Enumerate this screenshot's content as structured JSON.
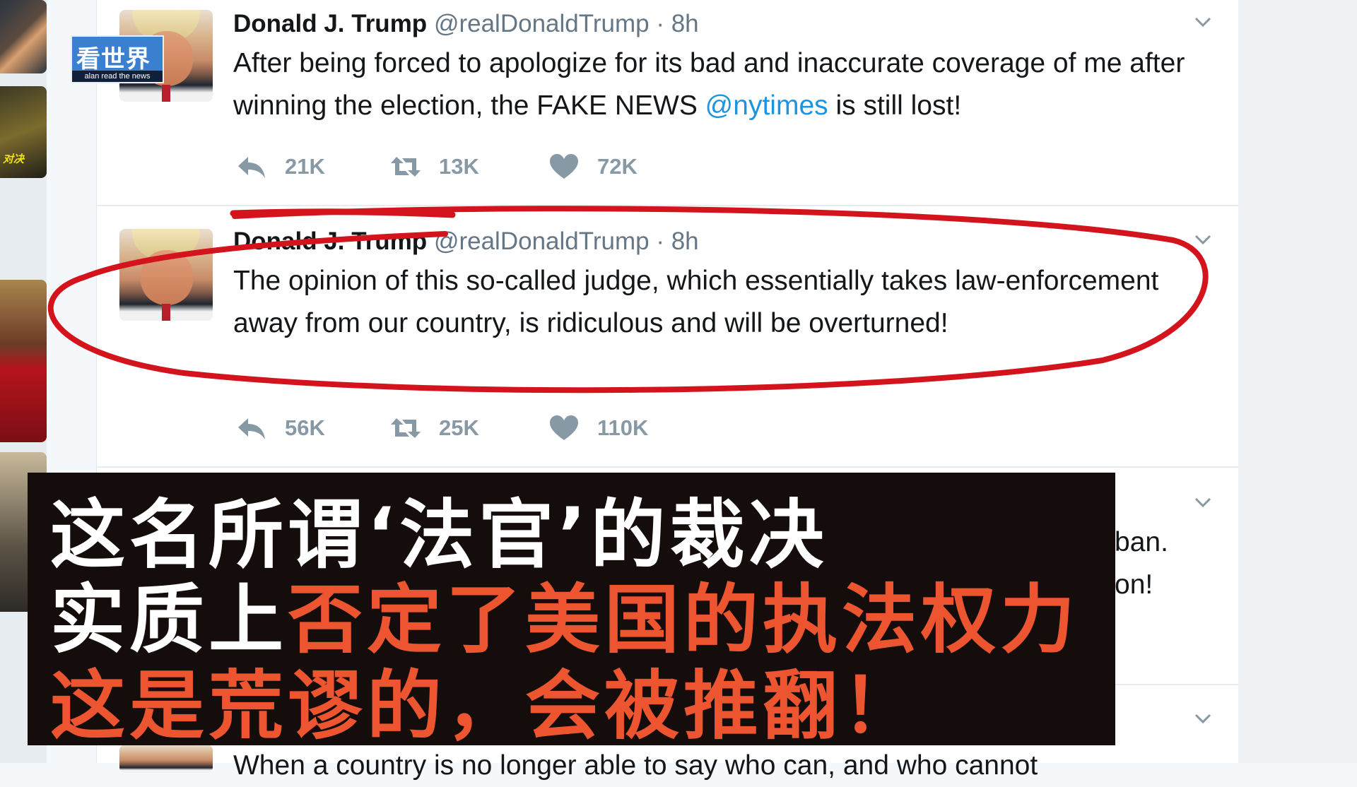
{
  "logo": {
    "title": "看世界",
    "subtitle": "alan read the news"
  },
  "thumb_caption": "对决",
  "tweets": [
    {
      "name": "Donald J. Trump",
      "handle": "@realDonaldTrump",
      "time": "8h",
      "text_before": "After being forced to apologize for its bad and inaccurate coverage of me after winning the election, the FAKE NEWS ",
      "mention": "@nytimes",
      "text_after": " is still lost!",
      "replies": "21K",
      "retweets": "13K",
      "likes": "72K"
    },
    {
      "name": "Donald J. Trump",
      "handle": "@realDonaldTrump",
      "time": "8h",
      "text": "The opinion of this so-called judge, which essentially takes law-enforcement away from our country, is ridiculous and will be overturned!",
      "replies": "56K",
      "retweets": "25K",
      "likes": "110K"
    }
  ],
  "partial_tweet": {
    "line1": "ban.",
    "line2": "on!"
  },
  "bottom_tweet": {
    "text": "When a country is no longer able to say who can, and who cannot"
  },
  "subtitle": {
    "line1": "这名所谓‘法官’的裁决",
    "line2_white": "实质上",
    "line2_red": "否定了美国的执法权力",
    "line3": "这是荒谬的，会被推翻！"
  },
  "colors": {
    "accent_red": "#ec5530",
    "mention_blue": "#1b95e0",
    "muted": "#8899a6",
    "annotation_red": "#d4141c"
  }
}
